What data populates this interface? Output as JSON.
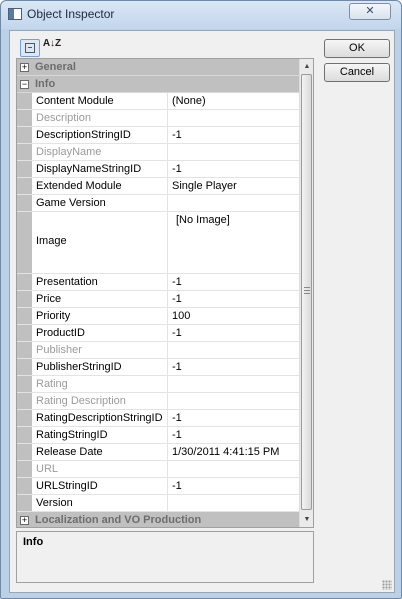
{
  "window": {
    "title": "Object Inspector",
    "close_label": "✕"
  },
  "toolbar": {
    "categorized_icon": "categorized-view-icon",
    "alphabetical_label": "A↓Z"
  },
  "buttons": {
    "ok_label": "OK",
    "cancel_label": "Cancel"
  },
  "categories": {
    "general": {
      "label": "General",
      "expander": "+"
    },
    "info": {
      "label": "Info",
      "expander": "−"
    },
    "localization": {
      "label": "Localization and VO Production",
      "expander": "+"
    }
  },
  "properties": [
    {
      "name": "Content Module",
      "value": "(None)"
    },
    {
      "name": "Description",
      "value": ""
    },
    {
      "name": "DescriptionStringID",
      "value": "-1"
    },
    {
      "name": "DisplayName",
      "value": ""
    },
    {
      "name": "DisplayNameStringID",
      "value": "-1"
    },
    {
      "name": "Extended Module",
      "value": "Single Player"
    },
    {
      "name": "Game Version",
      "value": ""
    },
    {
      "name": "Image",
      "value": "[No Image]"
    },
    {
      "name": "Presentation",
      "value": "-1"
    },
    {
      "name": "Price",
      "value": "-1"
    },
    {
      "name": "Priority",
      "value": "100"
    },
    {
      "name": "ProductID",
      "value": "-1"
    },
    {
      "name": "Publisher",
      "value": ""
    },
    {
      "name": "PublisherStringID",
      "value": "-1"
    },
    {
      "name": "Rating",
      "value": ""
    },
    {
      "name": "Rating Description",
      "value": ""
    },
    {
      "name": "RatingDescriptionStringID",
      "value": "-1"
    },
    {
      "name": "RatingStringID",
      "value": "-1"
    },
    {
      "name": "Release Date",
      "value": "1/30/2011 4:41:15 PM"
    },
    {
      "name": "URL",
      "value": ""
    },
    {
      "name": "URLStringID",
      "value": "-1"
    },
    {
      "name": "Version",
      "value": ""
    }
  ],
  "scrollbar": {
    "up_arrow": "▲",
    "down_arrow": "▼"
  },
  "description_panel": {
    "title": "Info"
  }
}
